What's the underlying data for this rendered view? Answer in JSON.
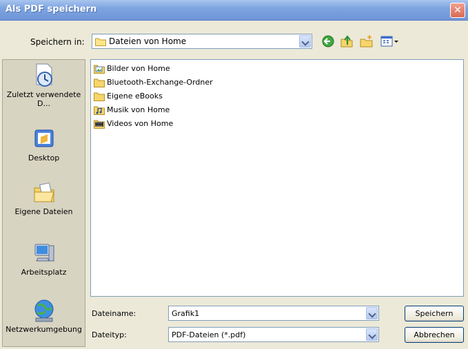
{
  "window": {
    "title": "Als PDF speichern",
    "close_glyph": "✕"
  },
  "lookin": {
    "label": "Speichern in:",
    "value": "Dateien von Home"
  },
  "toolbar": {
    "icons": [
      "back-icon",
      "up-folder-icon",
      "new-folder-icon",
      "view-menu-icon"
    ]
  },
  "places": [
    {
      "id": "recent",
      "label": "Zuletzt verwendete D...",
      "icon": "recent-documents-icon"
    },
    {
      "id": "desktop",
      "label": "Desktop",
      "icon": "desktop-icon"
    },
    {
      "id": "mydocs",
      "label": "Eigene Dateien",
      "icon": "my-documents-icon"
    },
    {
      "id": "mycomputer",
      "label": "Arbeitsplatz",
      "icon": "my-computer-icon"
    },
    {
      "id": "network",
      "label": "Netzwerkumgebung",
      "icon": "network-icon"
    }
  ],
  "files": [
    {
      "name": "Bilder von Home",
      "icon": "pictures-folder-icon"
    },
    {
      "name": "Bluetooth-Exchange-Ordner",
      "icon": "folder-icon"
    },
    {
      "name": "Eigene eBooks",
      "icon": "folder-icon"
    },
    {
      "name": "Musik von Home",
      "icon": "music-folder-icon"
    },
    {
      "name": "Videos von Home",
      "icon": "video-folder-icon"
    }
  ],
  "filename": {
    "label": "Dateiname:",
    "value": "Grafik1"
  },
  "filetype": {
    "label": "Dateityp:",
    "value": "PDF-Dateien (*.pdf)"
  },
  "buttons": {
    "save": "Speichern",
    "cancel": "Abbrechen"
  },
  "colors": {
    "title_bar": "#7ea4e0",
    "close_button": "#d86a52",
    "places_bar": "#d8d4c2",
    "dialog": "#ece9d8"
  }
}
